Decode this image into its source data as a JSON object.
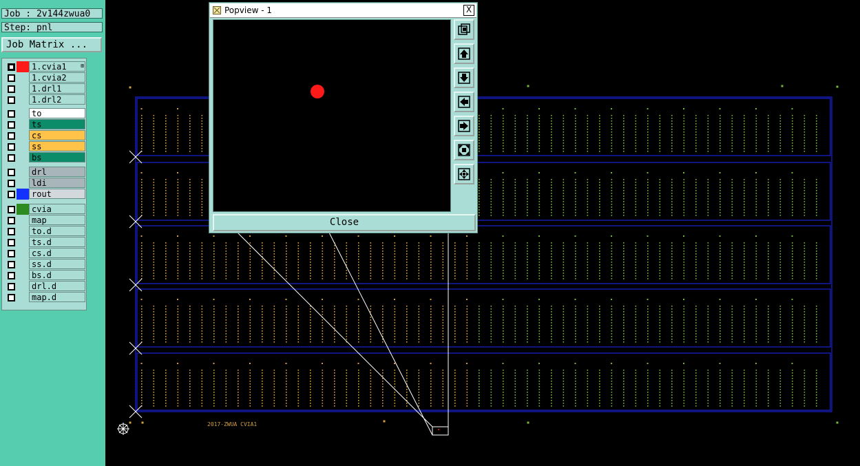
{
  "job": {
    "label": "Job : 2v144zwua0",
    "step": "Step: pnl",
    "matrix_button": "Job Matrix ..."
  },
  "layers": {
    "group1": [
      {
        "name": "1.cvia1",
        "color": "#ff1a1a",
        "name_bg": "#a9ddd6",
        "active": true,
        "expand": "⊞"
      },
      {
        "name": "1.cvia2",
        "color": "",
        "name_bg": "#a9ddd6",
        "active": false
      },
      {
        "name": "1.drl1",
        "color": "",
        "name_bg": "#a9ddd6",
        "active": false
      },
      {
        "name": "1.drl2",
        "color": "",
        "name_bg": "#a9ddd6",
        "active": false
      }
    ],
    "group2": [
      {
        "name": "to",
        "color": "",
        "name_bg": "#ffffff",
        "active": false
      },
      {
        "name": "ts",
        "color": "",
        "name_bg": "#0d8c6a",
        "active": false
      },
      {
        "name": "cs",
        "color": "",
        "name_bg": "#ffc34a",
        "active": false
      },
      {
        "name": "ss",
        "color": "",
        "name_bg": "#ffc34a",
        "active": false
      },
      {
        "name": "bs",
        "color": "",
        "name_bg": "#0d8c6a",
        "active": false
      }
    ],
    "group3": [
      {
        "name": "drl",
        "color": "",
        "name_bg": "#a8b6bb",
        "active": false
      },
      {
        "name": "ldi",
        "color": "",
        "name_bg": "#a8b6bb",
        "active": false
      },
      {
        "name": "rout",
        "color": "#1432ff",
        "name_bg": "#d3d8dc",
        "active": false
      }
    ],
    "group4": [
      {
        "name": "cvia",
        "color": "#2e8b22",
        "name_bg": "#a9ddd6",
        "active": false
      },
      {
        "name": "map",
        "color": "",
        "name_bg": "#a9ddd6",
        "active": false
      },
      {
        "name": "to.d",
        "color": "",
        "name_bg": "#a9ddd6",
        "active": false
      },
      {
        "name": "ts.d",
        "color": "",
        "name_bg": "#a9ddd6",
        "active": false
      },
      {
        "name": "cs.d",
        "color": "",
        "name_bg": "#a9ddd6",
        "active": false
      },
      {
        "name": "ss.d",
        "color": "",
        "name_bg": "#a9ddd6",
        "active": false
      },
      {
        "name": "bs.d",
        "color": "",
        "name_bg": "#a9ddd6",
        "active": false
      },
      {
        "name": "drl.d",
        "color": "",
        "name_bg": "#a9ddd6",
        "active": false
      },
      {
        "name": "map.d",
        "color": "",
        "name_bg": "#a9ddd6",
        "active": false
      }
    ]
  },
  "popview": {
    "title": "Popview - 1",
    "close_x": "X",
    "close_label": "Close",
    "tools": [
      "zoom-fit-icon",
      "pan-up-icon",
      "pan-down-icon",
      "pan-left-icon",
      "pan-right-icon",
      "zoom-in-icon",
      "zoom-out-icon"
    ]
  },
  "canvas": {
    "panel_label": "2017-ZWUA CVIA1",
    "colors": {
      "outline": "#1e28ff",
      "pad_orange": "#d2a043",
      "pad_green": "#78b43c",
      "selection": "#ffffff",
      "background": "#000000"
    }
  }
}
